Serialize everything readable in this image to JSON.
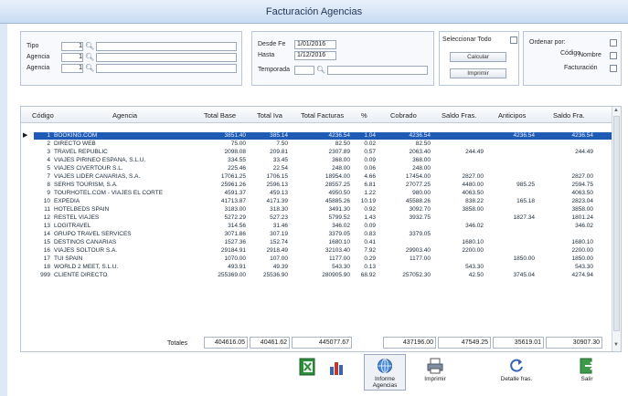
{
  "window": {
    "title": "Facturación Agencias"
  },
  "filters": {
    "tipo": {
      "label": "Tipo",
      "code": "1",
      "text": ""
    },
    "agencia_desde": {
      "label": "Agencia",
      "code": "1",
      "text": ""
    },
    "agencia_hasta": {
      "label": "Agencia",
      "code": "1",
      "text": ""
    }
  },
  "dates": {
    "desde": {
      "label": "Desde Fe",
      "value": "1/01/2016"
    },
    "hasta": {
      "label": "Hasta",
      "value": "1/12/2016"
    },
    "temporada": {
      "label": "Temporada",
      "code": "",
      "text": ""
    }
  },
  "actions": {
    "check_label": "Seleccionar Todo",
    "calcular": "Calcular",
    "imprimir": "Imprimir"
  },
  "order": {
    "title": "Ordenar por:",
    "opt1": "Código",
    "opt2": "Nombre",
    "opt3": "Facturación"
  },
  "grid": {
    "headers": [
      "Código",
      "Agencia",
      "Total Base",
      "Total Iva",
      "Total Facturas",
      "%",
      "Cobrado",
      "Saldo Fras.",
      "Anticipos",
      "Saldo Fra."
    ],
    "rows": [
      [
        "1",
        "BOOKING.COM",
        "3851.40",
        "385.14",
        "4236.54",
        "1.04",
        "4236.54",
        "",
        "4236.54",
        "4236.54"
      ],
      [
        "2",
        "DIRECTO WEB",
        "75.00",
        "7.50",
        "82.50",
        "0.02",
        "82.50",
        "",
        "",
        ""
      ],
      [
        "3",
        "TRAVEL REPUBLIC",
        "2098.08",
        "209.81",
        "2307.89",
        "0.57",
        "2063.40",
        "244.49",
        "",
        "244.49"
      ],
      [
        "4",
        "VIAJES PIRINEO ESPAÑA, S.L.U.",
        "334.55",
        "33.45",
        "368.00",
        "0.09",
        "368.00",
        "",
        "",
        ""
      ],
      [
        "5",
        "VIAJES CIVERTOUR S.L.",
        "225.46",
        "22.54",
        "248.00",
        "0.06",
        "248.00",
        "",
        "",
        ""
      ],
      [
        "7",
        "VIAJES LIDER CANARIAS, S.A.",
        "17061.25",
        "1706.15",
        "18954.00",
        "4.66",
        "17454.00",
        "2827.00",
        "",
        "2827.00"
      ],
      [
        "8",
        "SERHS TOURISM, S.A.",
        "25961.26",
        "2596.13",
        "28557.25",
        "6.81",
        "27077.25",
        "4480.00",
        "985.25",
        "2594.75"
      ],
      [
        "9",
        "TOURHOTEL.COM - VIAJES EL CORTE",
        "4591.37",
        "459.13",
        "4950.50",
        "1.22",
        "980.00",
        "4063.50",
        "",
        "4063.50"
      ],
      [
        "10",
        "EXPEDIA",
        "41713.87",
        "4171.39",
        "45885.26",
        "10.19",
        "45588.26",
        "838.22",
        "165.18",
        "2823.04"
      ],
      [
        "11",
        "HOTELBEDS SPAIN",
        "3183.00",
        "318.30",
        "3491.30",
        "0.92",
        "3092.70",
        "3858.00",
        "",
        "3858.00"
      ],
      [
        "12",
        "RESTEL VIAJES",
        "5272.29",
        "527.23",
        "5799.52",
        "1.43",
        "3932.75",
        "",
        "1827.34",
        "1801.24"
      ],
      [
        "13",
        "LOGITRAVEL",
        "314.56",
        "31.46",
        "346.02",
        "0.09",
        "",
        "346.02",
        "",
        "346.02"
      ],
      [
        "14",
        "GRUPO TRAVEL SERVICES",
        "3071.86",
        "307.19",
        "3379.05",
        "0.83",
        "3379.05",
        "",
        "",
        ""
      ],
      [
        "15",
        "DESTINOS CANARIAS",
        "1527.36",
        "152.74",
        "1680.10",
        "0.41",
        "",
        "1680.10",
        "",
        "1680.10"
      ],
      [
        "16",
        "VIAJES SOLTOUR S.A.",
        "29184.91",
        "2918.49",
        "32103.40",
        "7.92",
        "29903.40",
        "2200.00",
        "",
        "2200.00"
      ],
      [
        "17",
        "TUI SPAIN",
        "1070.00",
        "107.00",
        "1177.00",
        "0.29",
        "1177.00",
        "",
        "1850.00",
        "1850.00"
      ],
      [
        "18",
        "WORLD 2 MEET, S.L.U.",
        "493.91",
        "49.39",
        "543.30",
        "0.13",
        "",
        "543.30",
        "",
        "543.30"
      ],
      [
        "999",
        "CLIENTE DIRECTO",
        "255369.00",
        "25536.90",
        "280905.90",
        "68.92",
        "257052.30",
        "42.50",
        "3745.04",
        "4274.94"
      ]
    ],
    "selected_row": 0
  },
  "totals": {
    "label": "Totales",
    "base": "404616.05",
    "iva": "40461.62",
    "facturas": "445077.67",
    "cobrado": "437196.00",
    "saldo": "47549.25",
    "anticipos": "35619.01",
    "saldo_fra": "30907.30"
  },
  "toolbar": [
    {
      "label": "",
      "icon": "excel-icon"
    },
    {
      "label": "",
      "icon": "chart-icon"
    },
    {
      "label": "Informe Agencias",
      "icon": "globe-icon"
    },
    {
      "label": "Imprimir",
      "icon": "printer-icon"
    },
    {
      "label": "Detalle fras.",
      "icon": "refresh-icon"
    },
    {
      "label": "Salir",
      "icon": "exit-icon"
    }
  ],
  "colors": {
    "selection": "#1f5bb5",
    "title": "#1f3556",
    "excel": "#2e8b3e"
  }
}
